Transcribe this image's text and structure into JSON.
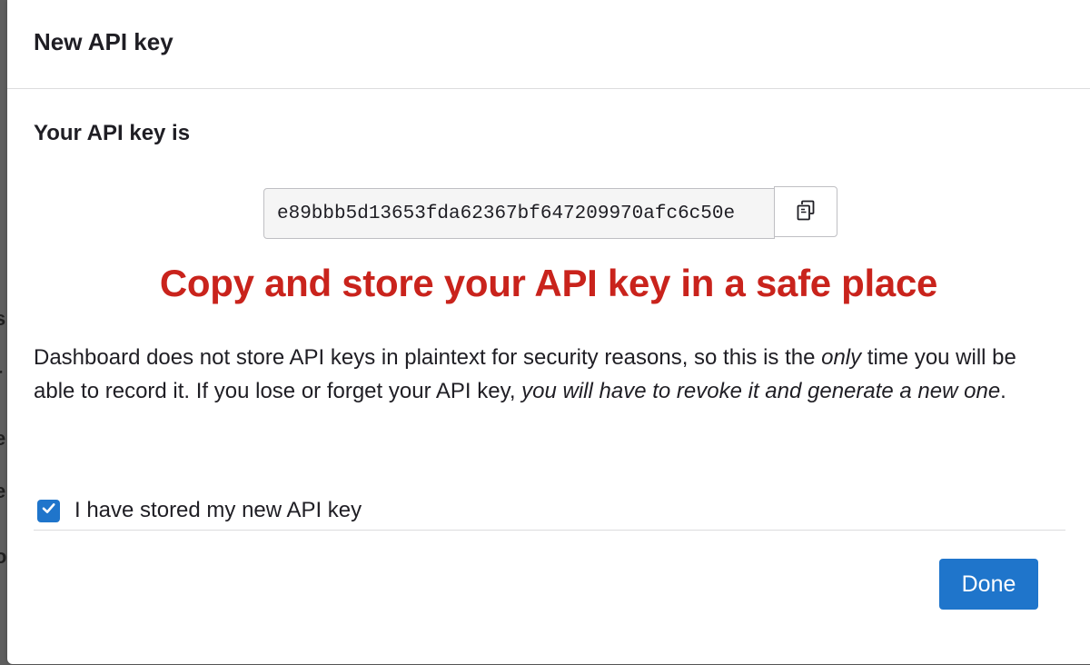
{
  "background": {
    "fragments": [
      "s",
      "r",
      "e",
      "e",
      "o"
    ]
  },
  "modal": {
    "title": "New API key",
    "key_label": "Your API key is",
    "api_key": "e89bbb5d13653fda62367bf647209970afc6c50e",
    "copy_icon": "copy-icon",
    "warning": "Copy and store your API key in a safe place",
    "description": {
      "part1": "Dashboard does not store API keys in plaintext for security reasons, so this is the ",
      "only": "only",
      "part2": " time you will be able to record it. If you lose or forget your API key, ",
      "emphasis": "you will have to revoke it and generate a new one",
      "part3": "."
    },
    "checkbox": {
      "checked": true,
      "label": "I have stored my new API key"
    },
    "done_label": "Done"
  },
  "colors": {
    "accent": "#1f75cb",
    "warning": "#c9231c"
  }
}
